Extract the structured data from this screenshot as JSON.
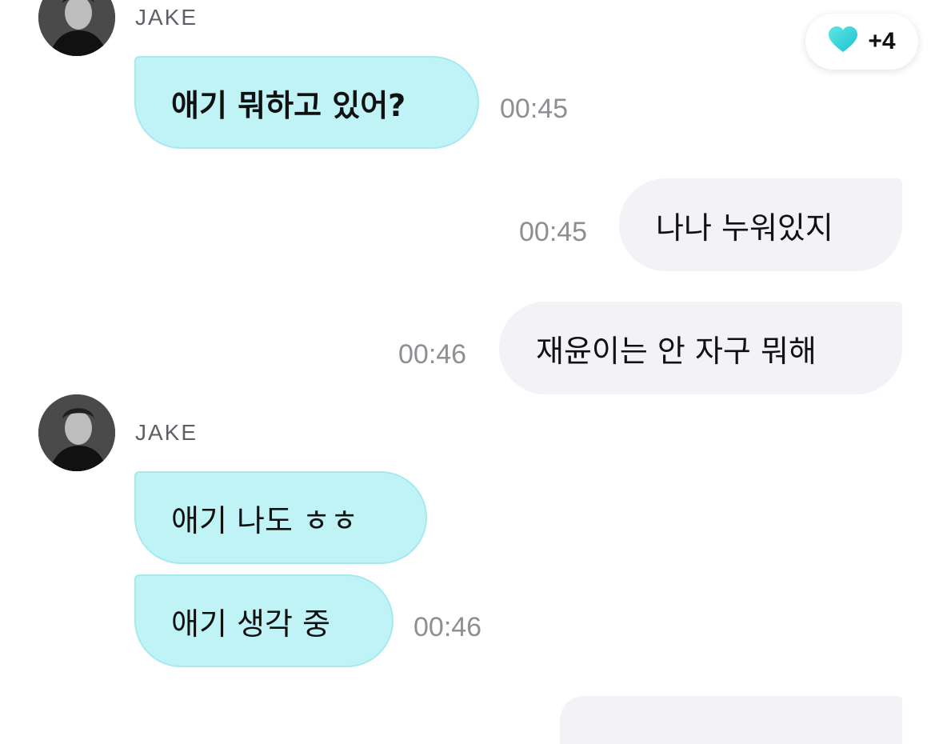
{
  "reaction": {
    "icon": "heart-icon",
    "color": "#35d3d9",
    "count": "+4"
  },
  "messages": [
    {
      "sender": "JAKE",
      "bubbles": [
        {
          "text": "애기 뭐하고 있어?",
          "time": "00:45"
        }
      ]
    },
    {
      "direction": "out",
      "text": "나나 누워있지",
      "time": "00:45"
    },
    {
      "direction": "out",
      "text": "재윤이는 안 자구 뭐해",
      "time": "00:46"
    },
    {
      "sender": "JAKE",
      "bubbles": [
        {
          "text": "애기 나도 ㅎㅎ"
        },
        {
          "text": "애기 생각 중",
          "time": "00:46"
        }
      ]
    }
  ],
  "colors": {
    "incoming_bubble": "#bff3f6",
    "outgoing_bubble": "#f2f2f7",
    "timestamp": "#8e8e93"
  }
}
